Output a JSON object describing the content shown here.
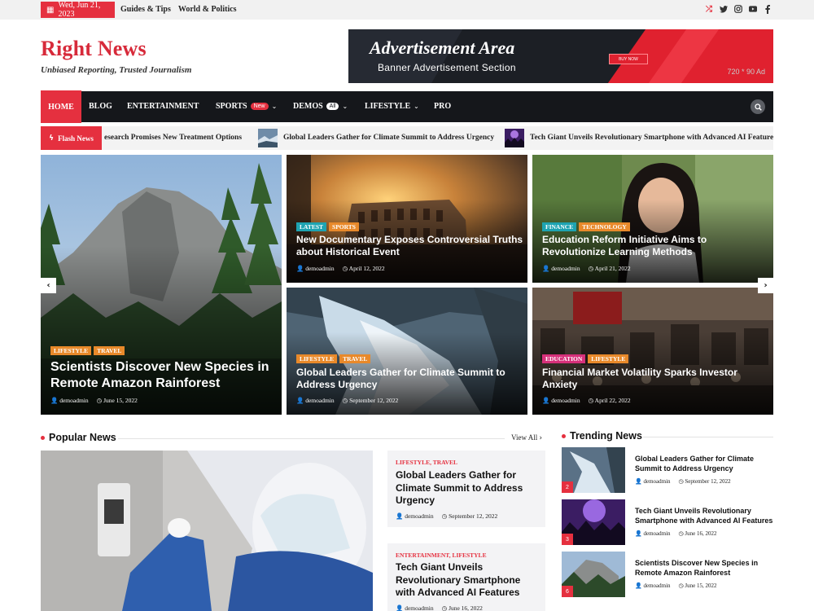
{
  "topbar": {
    "date": "Wed, Jun 21, 2023",
    "links": [
      "Guides & Tips",
      "World & Politics"
    ],
    "social_icons": [
      "shuffle-icon",
      "twitter-icon",
      "instagram-icon",
      "youtube-icon",
      "facebook-icon"
    ]
  },
  "header": {
    "brand": "Right News",
    "tagline": "Unbiased Reporting, Trusted Journalism"
  },
  "ad": {
    "title": "Advertisement Area",
    "subtitle": "Banner Advertisement Section",
    "button": "BUY NOW",
    "size": "720 * 90 Ad"
  },
  "nav": {
    "home": "HOME",
    "blog": "BLOG",
    "entertainment": "ENTERTAINMENT",
    "sports": "SPORTS",
    "sports_badge": "New",
    "demos": "DEMOS",
    "demos_badge": "All",
    "lifestyle": "LIFESTYLE",
    "pro": "PRO"
  },
  "flash": {
    "label": "Flash News",
    "items": [
      "esearch Promises New Treatment Options",
      "Global Leaders Gather for Climate Summit to Address Urgency",
      "Tech Giant Unveils Revolutionary Smartphone with Advanced AI Features"
    ]
  },
  "hero": {
    "big": {
      "tags": [
        "LIFESTYLE",
        "TRAVEL"
      ],
      "title": "Scientists Discover New Species in Remote Amazon Rainforest",
      "author": "demoadmin",
      "date": "June 15, 2022"
    },
    "cards": [
      {
        "tags": [
          "LATEST",
          "SPORTS"
        ],
        "title": "New Documentary Exposes Controversial Truths about Historical Event",
        "author": "demoadmin",
        "date": "April 12, 2022"
      },
      {
        "tags": [
          "FINANCE",
          "TECHNOLOGY"
        ],
        "title": "Education Reform Initiative Aims to Revolutionize Learning Methods",
        "author": "demoadmin",
        "date": "April 21, 2022"
      },
      {
        "tags": [
          "LIFESTYLE",
          "TRAVEL"
        ],
        "title": "Global Leaders Gather for Climate Summit to Address Urgency",
        "author": "demoadmin",
        "date": "September 12, 2022"
      },
      {
        "tags": [
          "EDUCATION",
          "LIFESTYLE"
        ],
        "title": "Financial Market Volatility Sparks Investor Anxiety",
        "author": "demoadmin",
        "date": "April 22, 2022"
      }
    ]
  },
  "popular": {
    "title": "Popular News",
    "view_all": "View All",
    "items": [
      {
        "cats": "LIFESTYLE, TRAVEL",
        "title": "Global Leaders Gather for Climate Summit to Address Urgency",
        "author": "demoadmin",
        "date": "September 12, 2022"
      },
      {
        "cats": "ENTERTAINMENT, LIFESTYLE",
        "title": "Tech Giant Unveils Revolutionary Smartphone with Advanced AI Features",
        "author": "demoadmin",
        "date": "June 16, 2022"
      }
    ]
  },
  "trending": {
    "title": "Trending News",
    "items": [
      {
        "num": "2",
        "title": "Global Leaders Gather for Climate Summit to Address Urgency",
        "author": "demoadmin",
        "date": "September 12, 2022"
      },
      {
        "num": "3",
        "title": "Tech Giant Unveils Revolutionary Smartphone with Advanced AI Features",
        "author": "demoadmin",
        "date": "June 16, 2022"
      },
      {
        "num": "6",
        "title": "Scientists Discover New Species in Remote Amazon Rainforest",
        "author": "demoadmin",
        "date": "June 15, 2022"
      }
    ]
  },
  "colors": {
    "accent": "#e5303f",
    "nav_bg": "#15171b",
    "tag_orange": "#e8892a",
    "tag_teal": "#1ea3b1",
    "tag_pink": "#d6307a"
  }
}
